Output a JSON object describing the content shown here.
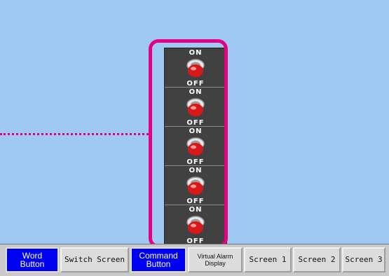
{
  "switches": [
    {
      "on_label": "ON",
      "off_label": "OFF"
    },
    {
      "on_label": "ON",
      "off_label": "OFF"
    },
    {
      "on_label": "ON",
      "off_label": "OFF"
    },
    {
      "on_label": "ON",
      "off_label": "OFF"
    },
    {
      "on_label": "ON",
      "off_label": "OFF"
    }
  ],
  "tabs": [
    {
      "label": "Word\nButton",
      "active": true
    },
    {
      "label": "Switch Screen",
      "active": false
    },
    {
      "label": "Command\nButton",
      "active": true
    },
    {
      "label": "Virtual Alarm\nDisplay",
      "active": false
    },
    {
      "label": "Screen 1",
      "active": false
    },
    {
      "label": "Screen 2",
      "active": false
    },
    {
      "label": "Screen 3",
      "active": false
    }
  ],
  "colors": {
    "background": "#9fc9f3",
    "highlight": "#e4007f",
    "active_tab": "#0000f0",
    "switch_panel": "#414141",
    "switch_knob": "#d81818"
  },
  "icons": {
    "switch": "red-toggle-switch-icon"
  }
}
